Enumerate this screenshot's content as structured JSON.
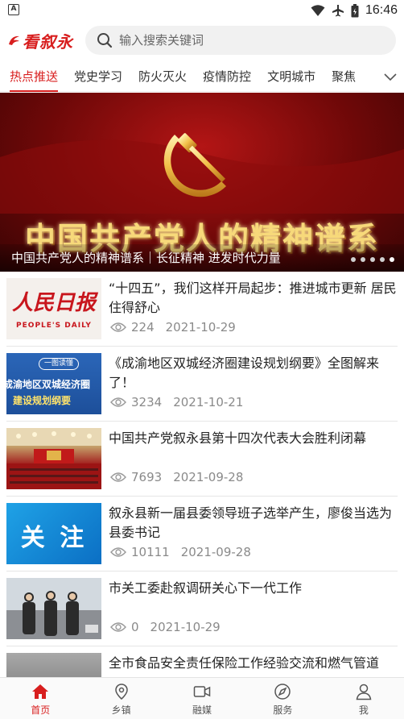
{
  "status_bar": {
    "time": "16:46"
  },
  "header": {
    "logo_text": "看叙永",
    "search_placeholder": "输入搜索关键词"
  },
  "tabs": [
    {
      "label": "热点推送",
      "active": true
    },
    {
      "label": "党史学习",
      "active": false
    },
    {
      "label": "防火灭火",
      "active": false
    },
    {
      "label": "疫情防控",
      "active": false
    },
    {
      "label": "文明城市",
      "active": false
    },
    {
      "label": "聚焦",
      "active": false
    }
  ],
  "banner": {
    "art_title": "中国共产党人的精神谱系",
    "caption": "中国共产党人的精神谱系｜长征精神 进发时代力量",
    "slide_count": 5,
    "active_slide": 5
  },
  "news": [
    {
      "title": "“十四五”，我们这样开局起步：推进城市更新 居民住得舒心",
      "views": "224",
      "date": "2021-10-29",
      "thumb": {
        "kind": "people-daily",
        "line1": "人民日报",
        "line2": "PEOPLE'S DAILY"
      }
    },
    {
      "title": "《成渝地区双城经济圈建设规划纲要》全图解来了！",
      "views": "3234",
      "date": "2021-10-21",
      "thumb": {
        "kind": "infographic",
        "tag": "一图读懂",
        "line1": "成渝地区双城经济圈",
        "line2": "建设规划纲要"
      }
    },
    {
      "title": "中国共产党叙永县第十四次代表大会胜利闭幕",
      "views": "7693",
      "date": "2021-09-28",
      "thumb": {
        "kind": "congress"
      }
    },
    {
      "title": "叙永县新一届县委领导班子选举产生，廖俊当选为县委书记",
      "views": "10111",
      "date": "2021-09-28",
      "thumb": {
        "kind": "focus",
        "text": "关 注"
      }
    },
    {
      "title": "市关工委赴叙调研关心下一代工作",
      "views": "0",
      "date": "2021-10-29",
      "thumb": {
        "kind": "photo"
      }
    },
    {
      "title": "全市食品安全责任保险工作经验交流和燃气管道",
      "views": "",
      "date": "",
      "thumb": {
        "kind": "photo2"
      }
    }
  ],
  "bottom_nav": [
    {
      "label": "首页",
      "icon": "home-icon",
      "active": true
    },
    {
      "label": "乡镇",
      "icon": "location-pin-icon",
      "active": false
    },
    {
      "label": "融媒",
      "icon": "video-camera-icon",
      "active": false
    },
    {
      "label": "服务",
      "icon": "compass-icon",
      "active": false
    },
    {
      "label": "我",
      "icon": "user-icon",
      "active": false
    }
  ],
  "colors": {
    "accent": "#d81e1e"
  }
}
